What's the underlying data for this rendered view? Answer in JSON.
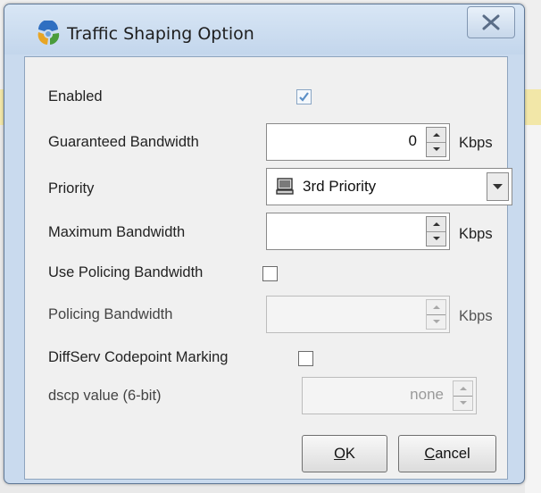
{
  "dialog": {
    "title": "Traffic Shaping Option",
    "close_icon": "close-x-icon",
    "app_icon": "app-logo-icon"
  },
  "form": {
    "enabled": {
      "label": "Enabled",
      "checked": true
    },
    "guaranteed_bandwidth": {
      "label": "Guaranteed Bandwidth",
      "value": "0",
      "unit": "Kbps"
    },
    "priority": {
      "label": "Priority",
      "value": "3rd Priority",
      "icon": "computer-icon"
    },
    "maximum_bandwidth": {
      "label": "Maximum Bandwidth",
      "value": "",
      "unit": "Kbps"
    },
    "use_policing_bandwidth": {
      "label": "Use Policing Bandwidth",
      "checked": false
    },
    "policing_bandwidth": {
      "label": "Policing Bandwidth",
      "value": "",
      "unit": "Kbps",
      "disabled": true
    },
    "diffserv_marking": {
      "label": "DiffServ Codepoint Marking",
      "checked": false
    },
    "dscp_value": {
      "label": "dscp value (6-bit)",
      "value": "none",
      "disabled": true
    }
  },
  "buttons": {
    "ok": {
      "mnemonic": "O",
      "rest": "K"
    },
    "cancel": {
      "mnemonic": "C",
      "rest": "ancel"
    }
  },
  "colors": {
    "frame": "#c9daee",
    "client": "#f0f0f0",
    "check_accent": "#5b8fc7"
  }
}
